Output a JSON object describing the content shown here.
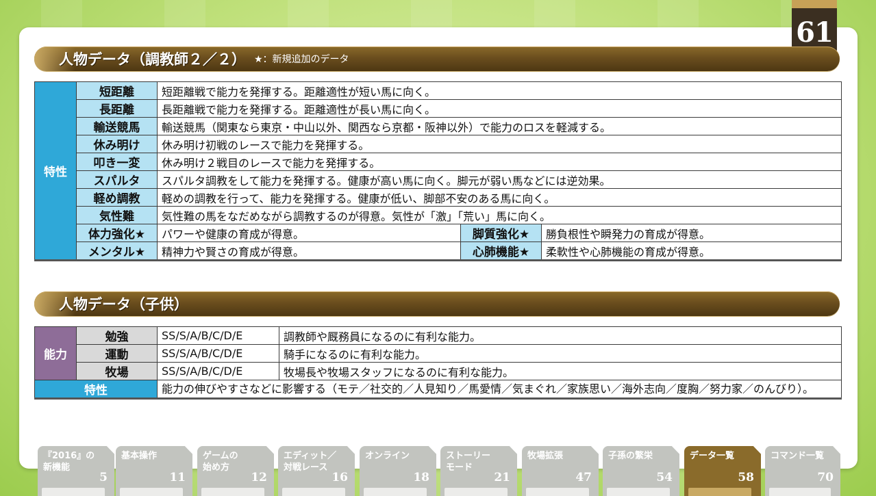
{
  "page_number": "61",
  "section1": {
    "title": "人物データ（調教師２／２）",
    "note": "★：新規追加のデータ",
    "category": "特性",
    "rows": [
      {
        "key": "短距離",
        "desc": "短距離戦で能力を発揮する。距離適性が短い馬に向く。"
      },
      {
        "key": "長距離",
        "desc": "長距離戦で能力を発揮する。距離適性が長い馬に向く。"
      },
      {
        "key": "輸送競馬",
        "desc": "輸送競馬（関東なら東京・中山以外、関西なら京都・阪神以外）で能力のロスを軽減する。"
      },
      {
        "key": "休み明け",
        "desc": "休み明け初戦のレースで能力を発揮する。"
      },
      {
        "key": "叩き一変",
        "desc": "休み明け２戦目のレースで能力を発揮する。"
      },
      {
        "key": "スパルタ",
        "desc": "スパルタ調教をして能力を発揮する。健康が高い馬に向く。脚元が弱い馬などには逆効果。"
      },
      {
        "key": "軽め調教",
        "desc": "軽めの調教を行って、能力を発揮する。健康が低い、脚部不安のある馬に向く。"
      },
      {
        "key": "気性難",
        "desc": "気性難の馬をなだめながら調教するのが得意。気性が「激」「荒い」馬に向く。"
      }
    ],
    "pairs": [
      {
        "key1": "体力強化★",
        "desc1": "パワーや健康の育成が得意。",
        "key2": "脚質強化★",
        "desc2": "勝負根性や瞬発力の育成が得意。"
      },
      {
        "key1": "メンタル★",
        "desc1": "精神力や賢さの育成が得意。",
        "key2": "心肺機能★",
        "desc2": "柔軟性や心肺機能の育成が得意。"
      }
    ]
  },
  "section2": {
    "title": "人物データ（子供）",
    "category": "能力",
    "rows": [
      {
        "key": "勉強",
        "grade": "SS/S/A/B/C/D/E",
        "desc": "調教師や厩務員になるのに有利な能力。"
      },
      {
        "key": "運動",
        "grade": "SS/S/A/B/C/D/E",
        "desc": "騎手になるのに有利な能力。"
      },
      {
        "key": "牧場",
        "grade": "SS/S/A/B/C/D/E",
        "desc": "牧場長や牧場スタッフになるのに有利な能力。"
      }
    ],
    "trait_key": "特性",
    "trait_desc": "能力の伸びやすさなどに影響する（モテ／社交的／人見知り／馬愛情／気まぐれ／家族思い／海外志向／度胸／努力家／のんびり）。"
  },
  "nav_tabs": [
    {
      "label": "『2016』の\n新機能",
      "page": "5"
    },
    {
      "label": "基本操作",
      "page": "11"
    },
    {
      "label": "ゲームの\n始め方",
      "page": "12"
    },
    {
      "label": "エディット／\n対戦レース",
      "page": "16"
    },
    {
      "label": "オンライン",
      "page": "18"
    },
    {
      "label": "ストーリー\nモード",
      "page": "21"
    },
    {
      "label": "牧場拡張",
      "page": "47"
    },
    {
      "label": "子孫の繁栄",
      "page": "54"
    },
    {
      "label": "データ一覧",
      "page": "58"
    },
    {
      "label": "コマンド一覧",
      "page": "70"
    }
  ],
  "colors": {
    "accent_blue": "#2fa8d8",
    "light_blue": "#b5e2f3",
    "purple": "#8e6d98",
    "gold": "#6b4e1e",
    "active_tab": "#8a6b2b"
  }
}
